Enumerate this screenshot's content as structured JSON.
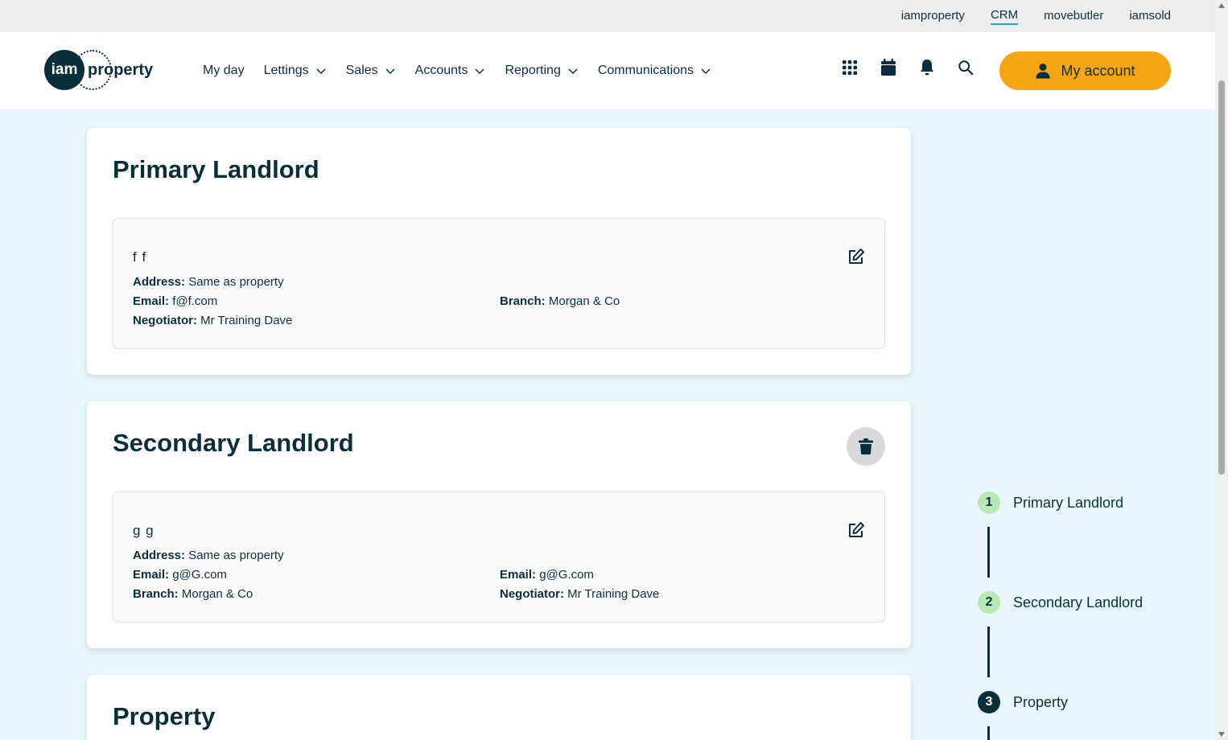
{
  "top_links": [
    "iamproperty",
    "CRM",
    "movebutler",
    "iamsold"
  ],
  "logo": {
    "circle_text": "iam",
    "word": "property"
  },
  "nav": {
    "my_day": "My day",
    "lettings": "Lettings",
    "sales": "Sales",
    "accounts": "Accounts",
    "reporting": "Reporting",
    "communications": "Communications"
  },
  "header_icons": [
    "apps-grid-icon",
    "calendar-icon",
    "bell-icon",
    "search-icon"
  ],
  "my_account": "My account",
  "primary": {
    "title": "Primary Landlord",
    "name": "f f",
    "address_label": "Address:",
    "address": "Same as property",
    "email_label": "Email:",
    "email": "f@f.com",
    "branch_label": "Branch:",
    "branch": "Morgan & Co",
    "negotiator_label": "Negotiator:",
    "negotiator": "Mr Training Dave"
  },
  "secondary": {
    "title": "Secondary Landlord",
    "name": "g g",
    "address_label": "Address:",
    "address": "Same as property",
    "email_label": "Email:",
    "email": "g@G.com",
    "email2_label": "Email:",
    "email2": "g@G.com",
    "branch_label": "Branch:",
    "branch": "Morgan & Co",
    "negotiator_label": "Negotiator:",
    "negotiator": "Mr Training Dave"
  },
  "property": {
    "title": "Property"
  },
  "steps": [
    {
      "num": "1",
      "label": "Primary Landlord",
      "state": "done"
    },
    {
      "num": "2",
      "label": "Secondary Landlord",
      "state": "done"
    },
    {
      "num": "3",
      "label": "Property",
      "state": "current"
    }
  ],
  "colors": {
    "accent": "#f7a613",
    "navy": "#0b2f3a",
    "bg": "#e8f7fb",
    "step_done": "#b9e8b4"
  }
}
